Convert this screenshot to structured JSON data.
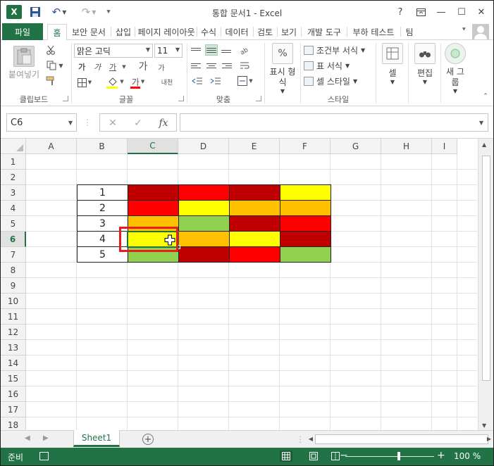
{
  "window": {
    "title": "통합 문서1 - Excel",
    "app_icon_label": "X",
    "controls": [
      "?",
      "🗖",
      "—",
      "☐",
      "✕"
    ]
  },
  "ribbon_tabs": {
    "file": "파일",
    "tabs": [
      "홈",
      "보안 문서",
      "삽입",
      "페이지 레이아웃",
      "수식",
      "데이터",
      "검토",
      "보기",
      "개발 도구",
      "부하 테스트",
      "팀"
    ],
    "active": "홈"
  },
  "ribbon": {
    "clipboard": {
      "paste": "붙여넣기",
      "label": "클립보드"
    },
    "font": {
      "name": "맑은 고딕",
      "size": "11",
      "label": "글꼴",
      "bold": "가",
      "italic": "가",
      "underline": "가",
      "grow": "가",
      "shrink": "가",
      "phonetic": "내천",
      "highlight_color": "#ffff00",
      "font_color": "#ff0000"
    },
    "alignment": {
      "label": "맞춤"
    },
    "number": {
      "format": "표시 형식",
      "percent": "%"
    },
    "styles": {
      "conditional": "조건부 서식",
      "table": "표 서식",
      "cell_styles": "셀 스타일",
      "label": "스타일"
    },
    "cells": {
      "label": "셀"
    },
    "editing": {
      "label": "편집"
    },
    "new_group": {
      "label": "새 그룹"
    }
  },
  "formula_bar": {
    "name_box": "C6",
    "cancel": "✕",
    "enter": "✓",
    "fx": "fx",
    "value": ""
  },
  "columns": [
    "A",
    "B",
    "C",
    "D",
    "E",
    "F",
    "G",
    "H",
    "I"
  ],
  "rows": [
    "1",
    "2",
    "3",
    "4",
    "5",
    "6",
    "7",
    "8",
    "9",
    "10",
    "11",
    "12",
    "13",
    "14",
    "15",
    "16",
    "17",
    "18"
  ],
  "active_cell": "C6",
  "table": {
    "labels": [
      "1",
      "2",
      "3",
      "4",
      "5"
    ],
    "colors": {
      "dark_red": "#c00000",
      "red": "#ff0000",
      "orange": "#ffc000",
      "yellow": "#ffff00",
      "green": "#92d050"
    },
    "fills": [
      [
        "dark_red",
        "red",
        "dark_red",
        "yellow"
      ],
      [
        "red",
        "yellow",
        "orange",
        "orange"
      ],
      [
        "orange",
        "green",
        "dark_red",
        "red"
      ],
      [
        "yellow",
        "orange",
        "yellow",
        "dark_red"
      ],
      [
        "green",
        "dark_red",
        "red",
        "green"
      ]
    ]
  },
  "sheets": {
    "names": [
      "Sheet1"
    ],
    "active": "Sheet1",
    "add": "+"
  },
  "status": {
    "text": "준비",
    "zoom": "100 %",
    "zoom_minus": "−",
    "zoom_plus": "+",
    "zoom_value": 100
  },
  "accent_color": "#217346"
}
